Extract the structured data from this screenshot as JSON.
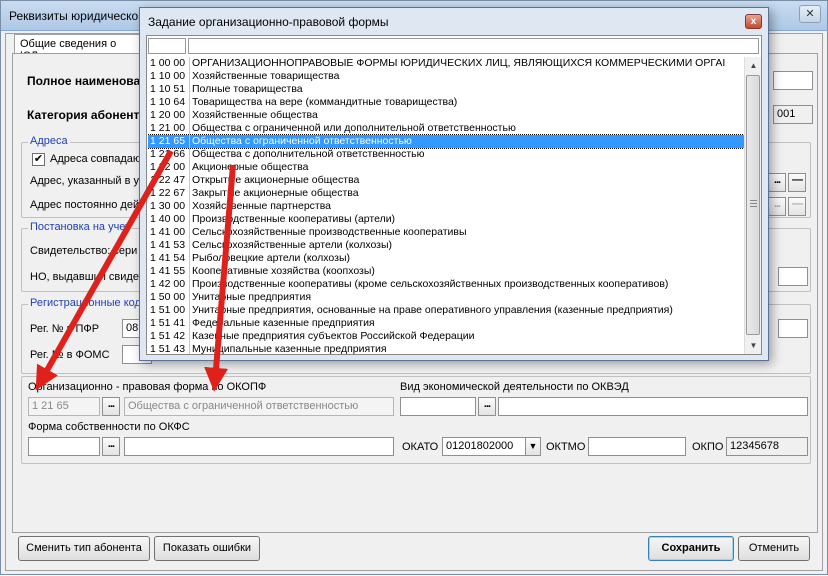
{
  "window": {
    "title": "Реквизиты юридическо",
    "close_glyph": "✕"
  },
  "tab": {
    "label": "Общие сведения о ЮЛ"
  },
  "main": {
    "full_name_label": "Полное наименова",
    "category_label": "Категория абонент",
    "category_value_suffix": "001",
    "address_group_title": "Адреса",
    "address_same_label": "Адреса совпадают",
    "address_same_checked": "✔",
    "address_indicated_label": "Адрес, указанный в у",
    "address_permanent_label": "Адрес постоянно дей",
    "registration_group_title": "Постановка на учет",
    "certificate_label": "Свидетельство: сери",
    "tax_office_label": "НО, выдавший свидет",
    "reg_codes_group_title": "Регистрационные код",
    "reg_pfr_label": "Рег. № в ПФР",
    "reg_pfr_value": "08",
    "reg_foms_label": "Рег. № в ФОМС"
  },
  "okopf": {
    "label": "Организационно - правовая форма по ОКОПФ",
    "code": "1 21 65",
    "name": "Общества с ограниченной ответственностью"
  },
  "okved": {
    "label": "Вид экономической деятельности по ОКВЭД"
  },
  "okfs": {
    "label": "Форма собственности по ОКФС"
  },
  "okato": {
    "label": "ОКАТО",
    "value": "01201802000"
  },
  "oktmo": {
    "label": "ОКТМО"
  },
  "okpo": {
    "label": "ОКПО",
    "value": "12345678"
  },
  "buttons": {
    "change_type": "Сменить тип абонента",
    "show_errors": "Показать ошибки",
    "save": "Сохранить",
    "cancel": "Отменить",
    "dots": "...",
    "minus": "—"
  },
  "modal": {
    "title": "Задание организационно-правовой формы",
    "close_glyph": "x",
    "selected_index": 6,
    "rows": [
      {
        "code": "1 00 00",
        "name": "ОРГАНИЗАЦИОННОПРАВОВЫЕ ФОРМЫ ЮРИДИЧЕСКИХ ЛИЦ, ЯВЛЯЮЩИХСЯ КОММЕРЧЕСКИМИ ОРГАІ"
      },
      {
        "code": "1 10 00",
        "name": "Хозяйственные товарищества"
      },
      {
        "code": "1 10 51",
        "name": "Полные товарищества"
      },
      {
        "code": "1 10 64",
        "name": "Товарищества на вере (коммандитные товарищества)"
      },
      {
        "code": "1 20 00",
        "name": "Хозяйственные общества"
      },
      {
        "code": "1 21 00",
        "name": "Общества с ограниченной или дополнительной ответственностью"
      },
      {
        "code": "1 21 65",
        "name": "Общества с ограниченной ответственностью"
      },
      {
        "code": "1 21 66",
        "name": "Общества с дополнительной ответственностью"
      },
      {
        "code": "1 22 00",
        "name": "Акционерные общества"
      },
      {
        "code": "1 22 47",
        "name": "Открытые акционерные общества"
      },
      {
        "code": "1 22 67",
        "name": "Закрытые акционерные общества"
      },
      {
        "code": "1 30 00",
        "name": "Хозяйственные партнерства"
      },
      {
        "code": "1 40 00",
        "name": "Производственные кооперативы (артели)"
      },
      {
        "code": "1 41 00",
        "name": "Сельскохозяйственные производственные кооперативы"
      },
      {
        "code": "1 41 53",
        "name": "Сельскохозяйственные артели (колхозы)"
      },
      {
        "code": "1 41 54",
        "name": "Рыболовецкие артели (колхозы)"
      },
      {
        "code": "1 41 55",
        "name": "Кооперативные хозяйства (коопхозы)"
      },
      {
        "code": "1 42 00",
        "name": "Производственные кооперативы (кроме сельскохозяйственных производственных кооперативов)"
      },
      {
        "code": "1 50 00",
        "name": "Унитарные предприятия"
      },
      {
        "code": "1 51 00",
        "name": "Унитарные предприятия, основанные на праве оперативного управления (казенные предприятия)"
      },
      {
        "code": "1 51 41",
        "name": "Федеральные казенные предприятия"
      },
      {
        "code": "1 51 42",
        "name": "Казенные предприятия субъектов Российской Федерации"
      },
      {
        "code": "1 51 43",
        "name": "Муниципальные казенные предприятия"
      }
    ]
  },
  "colors": {
    "arrow": "#e0201a",
    "selection": "#3399ff",
    "group_title": "#1f3fb4"
  }
}
